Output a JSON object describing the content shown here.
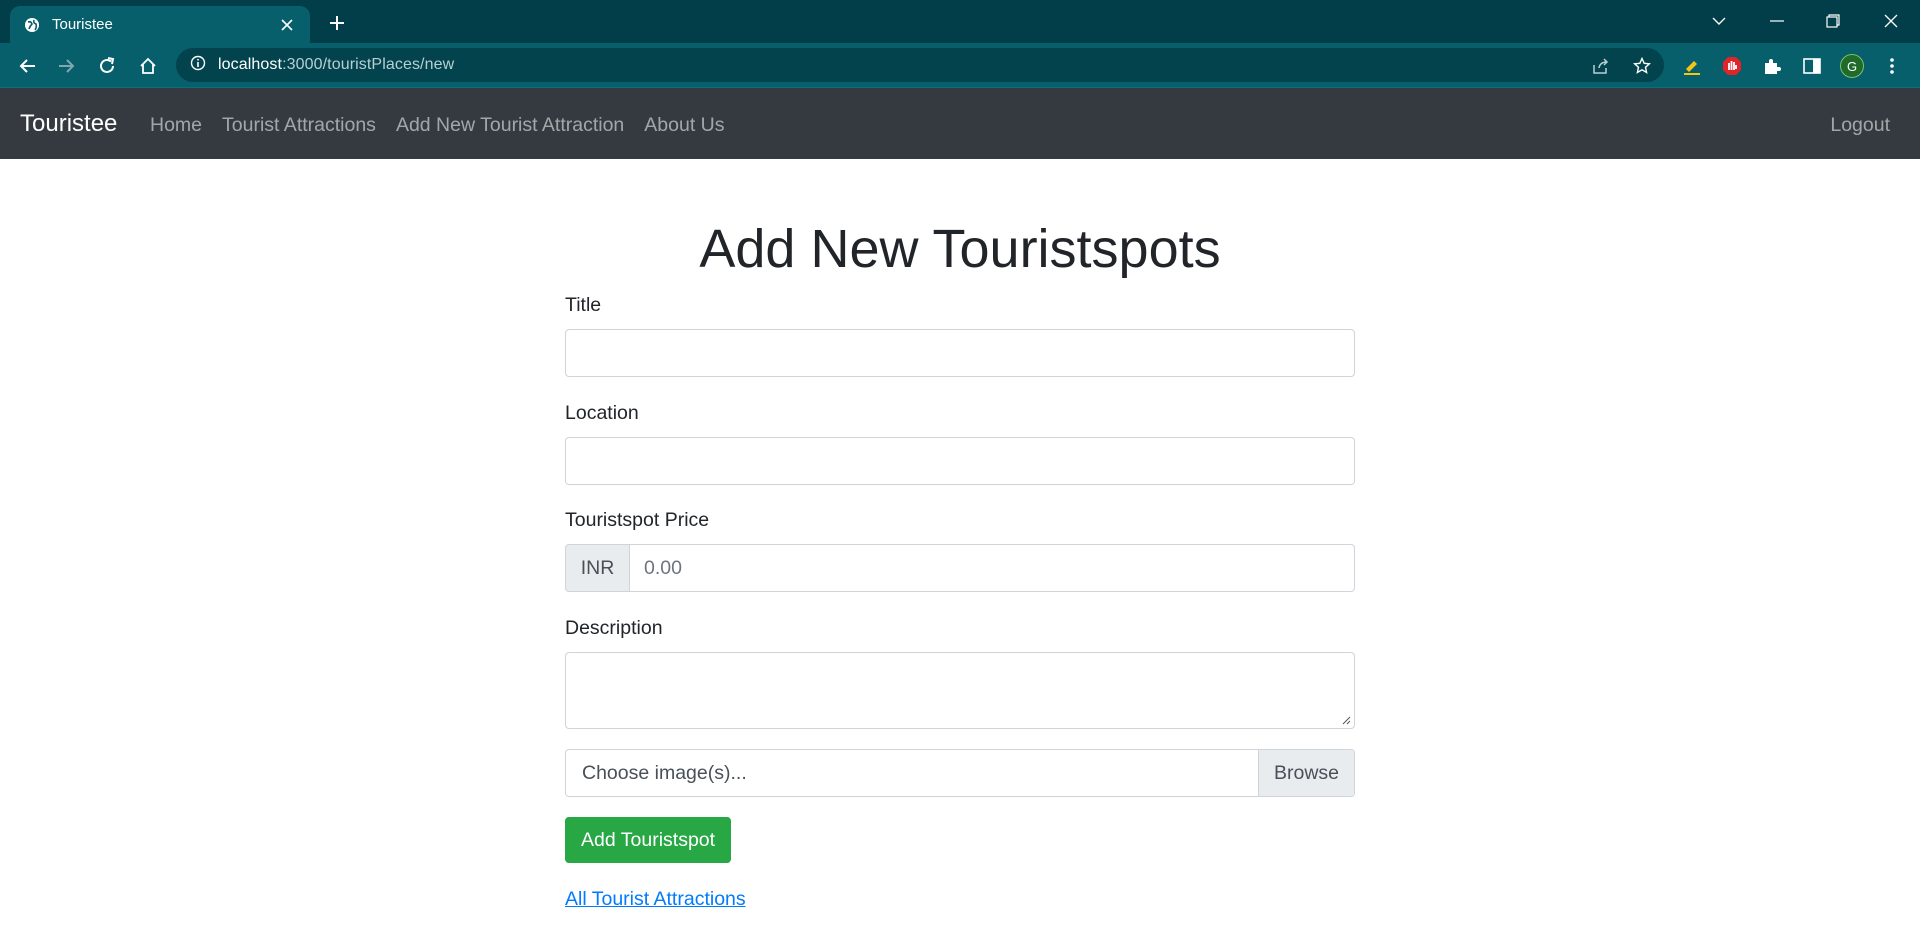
{
  "browser": {
    "tab_title": "Touristee",
    "url_host": "localhost",
    "url_path": ":3000/touristPlaces/new",
    "profile_initial": "G"
  },
  "navbar": {
    "brand": "Touristee",
    "links": [
      "Home",
      "Tourist Attractions",
      "Add New Tourist Attraction",
      "About Us"
    ],
    "logout": "Logout"
  },
  "form": {
    "heading": "Add New Touristspots",
    "title_label": "Title",
    "location_label": "Location",
    "price_label": "Touristspot Price",
    "currency": "INR",
    "price_placeholder": "0.00",
    "description_label": "Description",
    "file_placeholder": "Choose image(s)...",
    "browse_label": "Browse",
    "submit_label": "Add Touristspot",
    "back_link": "All Tourist Attractions"
  },
  "colors": {
    "tabbar": "#013e49",
    "toolbar": "#075f6b",
    "navbar": "#343a40",
    "submit": "#28a745",
    "link": "#007bff"
  }
}
